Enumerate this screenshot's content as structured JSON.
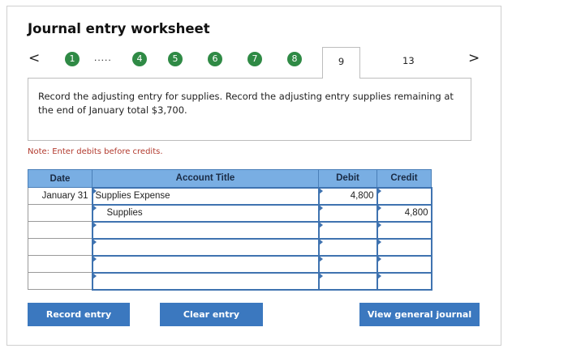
{
  "title": "Journal entry worksheet",
  "nav": {
    "prev_glyph": "<",
    "next_glyph": ">",
    "steps": [
      "1",
      "4",
      "5",
      "6",
      "7",
      "8"
    ],
    "ellipsis": ".....",
    "active_tab": "9",
    "next_tab": "13",
    "step_color": "#2f8a45"
  },
  "instruction": "Record the adjusting entry for supplies. Record the adjusting entry supplies remaining at the end of January total $3,700.",
  "note": "Note: Enter debits before credits.",
  "table": {
    "headers": {
      "date": "Date",
      "account": "Account Title",
      "debit": "Debit",
      "credit": "Credit"
    },
    "rows": [
      {
        "date": "January 31",
        "account": "Supplies Expense",
        "debit": "4,800",
        "credit": ""
      },
      {
        "date": "",
        "account": "Supplies",
        "debit": "",
        "credit": "4,800"
      },
      {
        "date": "",
        "account": "",
        "debit": "",
        "credit": ""
      },
      {
        "date": "",
        "account": "",
        "debit": "",
        "credit": ""
      },
      {
        "date": "",
        "account": "",
        "debit": "",
        "credit": ""
      },
      {
        "date": "",
        "account": "",
        "debit": "",
        "credit": ""
      }
    ]
  },
  "buttons": {
    "record": "Record entry",
    "clear": "Clear entry",
    "view": "View general journal"
  },
  "colors": {
    "header_bg": "#79aee3",
    "button_bg": "#3b78bf",
    "note_text": "#b23a2e"
  }
}
